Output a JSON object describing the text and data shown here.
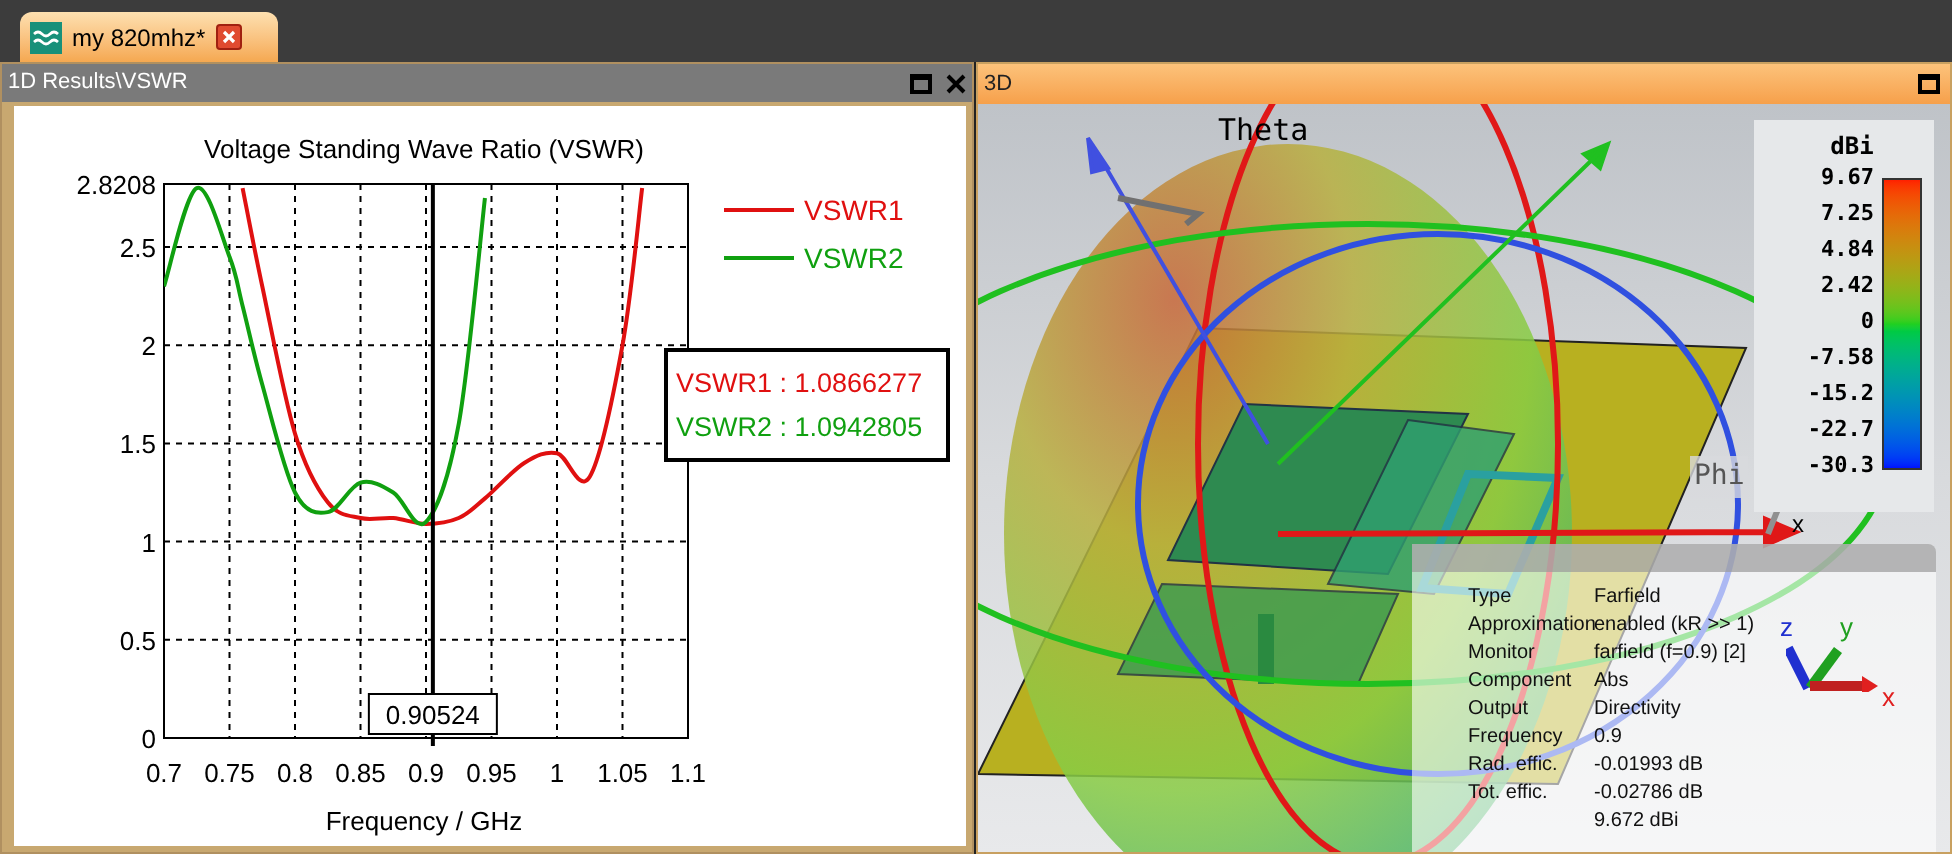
{
  "tabs": [
    {
      "label": "my 820mhz*",
      "selected": true
    }
  ],
  "left_panel": {
    "title": "1D Results\\VSWR",
    "chart_data": {
      "type": "line",
      "title": "Voltage Standing Wave Ratio (VSWR)",
      "xlabel": "Frequency / GHz",
      "x": [
        0.7,
        0.725,
        0.75,
        0.76,
        0.775,
        0.8,
        0.825,
        0.85,
        0.875,
        0.9,
        0.925,
        0.945,
        0.975,
        1.0,
        1.025,
        1.05,
        1.065
      ],
      "series": [
        {
          "name": "VSWR1",
          "color": "#e01010",
          "values": [
            null,
            null,
            null,
            2.8,
            2.3,
            1.55,
            1.2,
            1.12,
            1.12,
            1.09,
            1.12,
            1.22,
            1.4,
            1.45,
            1.33,
            2.0,
            2.8
          ]
        },
        {
          "name": "VSWR2",
          "color": "#10a010",
          "values": [
            2.3,
            2.8,
            2.45,
            2.2,
            1.8,
            1.25,
            1.15,
            1.3,
            1.25,
            1.1,
            1.6,
            2.75,
            null,
            null,
            null,
            null,
            null
          ]
        }
      ],
      "grid": true,
      "legend": "outside right",
      "xlim": [
        0.7,
        1.1
      ],
      "ylim": [
        0,
        2.8208
      ],
      "xticks": [
        0.7,
        0.75,
        0.8,
        0.85,
        0.9,
        0.95,
        1,
        1.05,
        1.1
      ],
      "yticks": [
        0,
        0.5,
        1,
        1.5,
        2,
        2.5,
        {
          "value": 2.8208,
          "label": "2.8208"
        }
      ],
      "ref_lines": [
        {
          "axis": "x",
          "value": 0.90524
        }
      ],
      "annotations": [
        "0.90524"
      ]
    },
    "readouts": [
      {
        "text": "VSWR1 : 1.0866277",
        "color": "#e01010"
      },
      {
        "text": "VSWR2 : 1.0942805",
        "color": "#10a010"
      }
    ]
  },
  "right_panel": {
    "title": "3D",
    "labels": {
      "theta": "Theta",
      "phi": "Phi",
      "axis_x": "x"
    },
    "color_scale": {
      "unit": "dBi",
      "ticks": [
        "9.67",
        "7.25",
        "4.84",
        "2.42",
        "0",
        "-7.58",
        "-15.2",
        "-22.7",
        "-30.3"
      ]
    },
    "info": [
      {
        "label": "Type",
        "value": "Farfield"
      },
      {
        "label": "Approximation",
        "value": "enabled (kR >> 1)"
      },
      {
        "label": "Monitor",
        "value": "farfield (f=0.9) [2]"
      },
      {
        "label": "Component",
        "value": "Abs"
      },
      {
        "label": "Output",
        "value": "Directivity"
      },
      {
        "label": "Frequency",
        "value": "0.9"
      },
      {
        "label": "Rad. effic.",
        "value": "-0.01993 dB"
      },
      {
        "label": "Tot. effic.",
        "value": "-0.02786 dB"
      },
      {
        "value": "9.672 dBi"
      }
    ],
    "triad": [
      "z",
      "y",
      "x"
    ]
  }
}
